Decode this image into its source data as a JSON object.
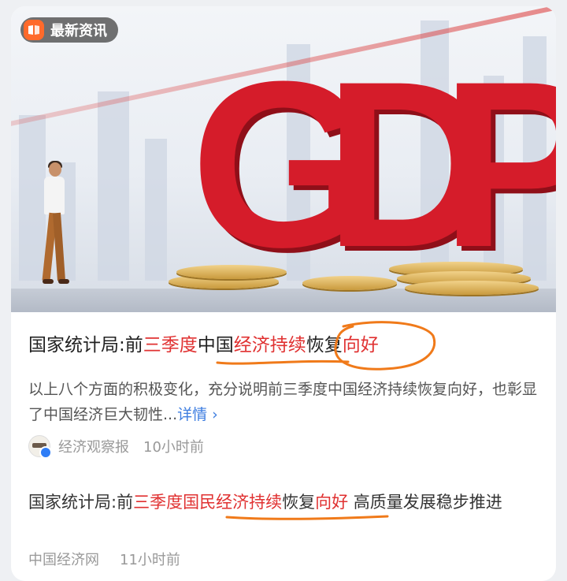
{
  "badge": {
    "label": "最新资讯",
    "icon": "book-icon",
    "icon_color": "#ff6a2b"
  },
  "hero": {
    "headline_text": "GDP",
    "accent": "#d51c2a"
  },
  "article1": {
    "title_parts": [
      "国家统计局:前",
      "三季度",
      "中国",
      "经济持续",
      "恢复",
      "向好"
    ],
    "snippet": "以上八个方面的积极变化，充分说明前三季度中国经济持续恢复向好，也彰显了中国经济巨大韧性...",
    "more_label": "详情 ›",
    "source": "经济观察报",
    "time": "10小时前"
  },
  "article2": {
    "title_parts": [
      "国家统计局:前",
      "三季度国民经济持续",
      "恢复",
      "向好",
      " 高质量发展稳步推进"
    ],
    "source": "中国经济网",
    "time": "11小时前"
  },
  "colors": {
    "highlight_red": "#e03131",
    "annotation_orange": "#f07a1a",
    "link_blue": "#3d7de0"
  }
}
